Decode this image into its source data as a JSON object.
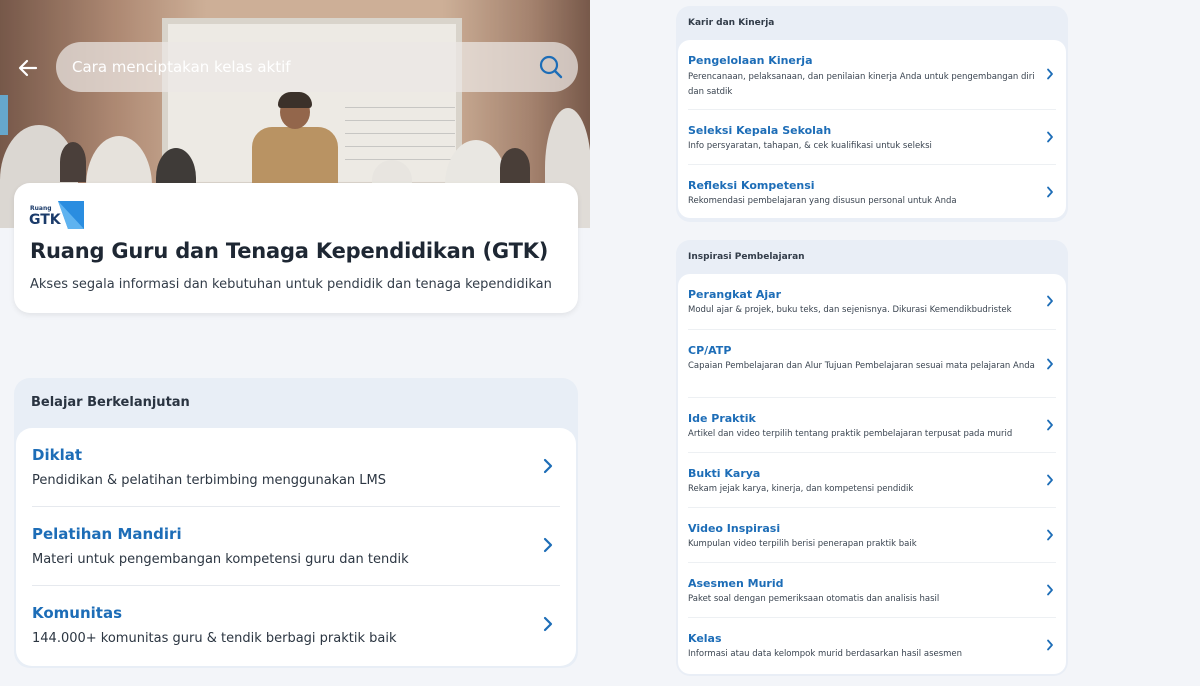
{
  "search": {
    "placeholder": "Cara menciptakan kelas aktif"
  },
  "hero_card": {
    "logo_small_text": "Ruang",
    "logo_text": "GTK",
    "title": "Ruang Guru dan Tenaga Kependidikan (GTK)",
    "subtitle": "Akses segala informasi dan kebutuhan untuk pendidik dan tenaga kependidikan"
  },
  "belajar": {
    "header": "Belajar Berkelanjutan",
    "items": [
      {
        "title": "Diklat",
        "desc": "Pendidikan & pelatihan terbimbing menggunakan LMS"
      },
      {
        "title": "Pelatihan Mandiri",
        "desc": "Materi untuk pengembangan kompetensi guru dan tendik"
      },
      {
        "title": "Komunitas",
        "desc": "144.000+ komunitas guru & tendik berbagi praktik baik"
      }
    ]
  },
  "karir": {
    "header": "Karir dan Kinerja",
    "items": [
      {
        "title": "Pengelolaan Kinerja",
        "desc": "Perencanaan, pelaksanaan, dan penilaian kinerja Anda untuk pengembangan diri dan satdik"
      },
      {
        "title": "Seleksi Kepala Sekolah",
        "desc": "Info persyaratan, tahapan, & cek kualifikasi untuk seleksi"
      },
      {
        "title": "Refleksi Kompetensi",
        "desc": "Rekomendasi pembelajaran yang disusun personal untuk Anda"
      }
    ]
  },
  "inspirasi": {
    "header": "Inspirasi Pembelajaran",
    "items": [
      {
        "title": "Perangkat Ajar",
        "desc": "Modul ajar & projek, buku teks, dan sejenisnya. Dikurasi Kemendikbudristek"
      },
      {
        "title": "CP/ATP",
        "desc": "Capaian Pembelajaran dan Alur Tujuan Pembelajaran sesuai mata pelajaran Anda"
      },
      {
        "title": "Ide Praktik",
        "desc": "Artikel dan video terpilih tentang praktik pembelajaran terpusat pada murid"
      },
      {
        "title": "Bukti Karya",
        "desc": "Rekam jejak karya, kinerja, dan kompetensi pendidik"
      },
      {
        "title": "Video Inspirasi",
        "desc": "Kumpulan video terpilih berisi penerapan praktik baik"
      },
      {
        "title": "Asesmen Murid",
        "desc": "Paket soal dengan pemeriksaan otomatis dan analisis hasil"
      },
      {
        "title": "Kelas",
        "desc": "Informasi atau data kelompok murid berdasarkan hasil asesmen"
      }
    ]
  },
  "colors": {
    "link_blue": "#1d6db7",
    "logo_blue": "#2a8de0",
    "page_bg": "#f3f5f9"
  }
}
